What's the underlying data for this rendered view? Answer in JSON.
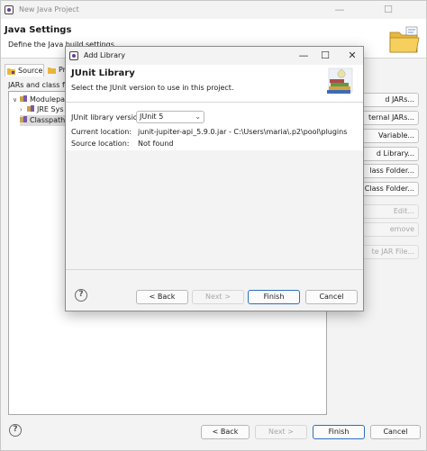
{
  "outer_window": {
    "title": "New Java Project",
    "header_title": "Java Settings",
    "header_desc": "Define the Java build settings.",
    "tabs": [
      {
        "label": "Source"
      },
      {
        "label": "Pr"
      }
    ],
    "jars_label": "JARs and class fol",
    "tree": [
      {
        "label": "Modulepa",
        "indent": 0,
        "arrow": "∨",
        "selected": false
      },
      {
        "label": "JRE Sys",
        "indent": 1,
        "arrow": "›",
        "selected": false
      },
      {
        "label": "Classpath",
        "indent": 0,
        "arrow": "",
        "selected": true
      }
    ],
    "right_buttons": [
      {
        "label": "d JARs...",
        "enabled": true
      },
      {
        "label": "ternal JARs...",
        "enabled": true
      },
      {
        "label": "Variable...",
        "enabled": true
      },
      {
        "label": "d Library...",
        "enabled": true
      },
      {
        "label": "lass Folder...",
        "enabled": true
      },
      {
        "label": "nal Class Folder...",
        "enabled": true
      },
      {
        "label": "Edit...",
        "enabled": false
      },
      {
        "label": "emove",
        "enabled": false
      },
      {
        "label": "te JAR File...",
        "enabled": false
      }
    ],
    "buttons": {
      "back": "< Back",
      "next": "Next >",
      "finish": "Finish",
      "cancel": "Cancel"
    }
  },
  "dialog": {
    "title": "Add Library",
    "header_title": "JUnit Library",
    "header_desc": "Select the JUnit version to use in this project.",
    "version_label": "JUnit library version:",
    "version_value": "JUnit 5",
    "current_location_label": "Current location:",
    "current_location_value": "junit-jupiter-api_5.9.0.jar - C:\\Users\\maria\\.p2\\pool\\plugins",
    "source_location_label": "Source location:",
    "source_location_value": "Not found",
    "buttons": {
      "back": "< Back",
      "next": "Next >",
      "finish": "Finish",
      "cancel": "Cancel"
    }
  },
  "icons": {
    "help": "?",
    "minimize": "—",
    "maximize": "☐",
    "close": "✕"
  },
  "colors": {
    "accent_border": "#2f6fbd",
    "disabled_text": "#a8a8a8"
  }
}
